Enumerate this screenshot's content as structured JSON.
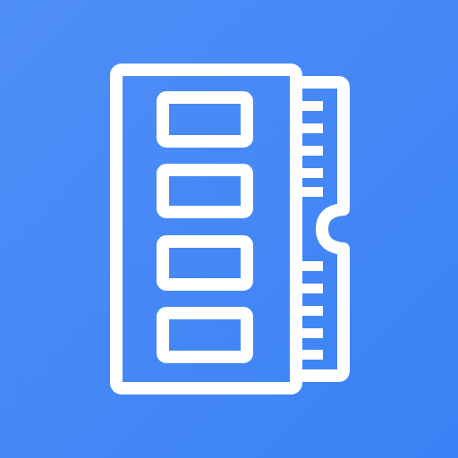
{
  "app_icon": {
    "icon": "memory-module-icon",
    "colors": {
      "background_start": "#4f8ef7",
      "background_end": "#3b82f6",
      "foreground": "#ffffff"
    }
  }
}
